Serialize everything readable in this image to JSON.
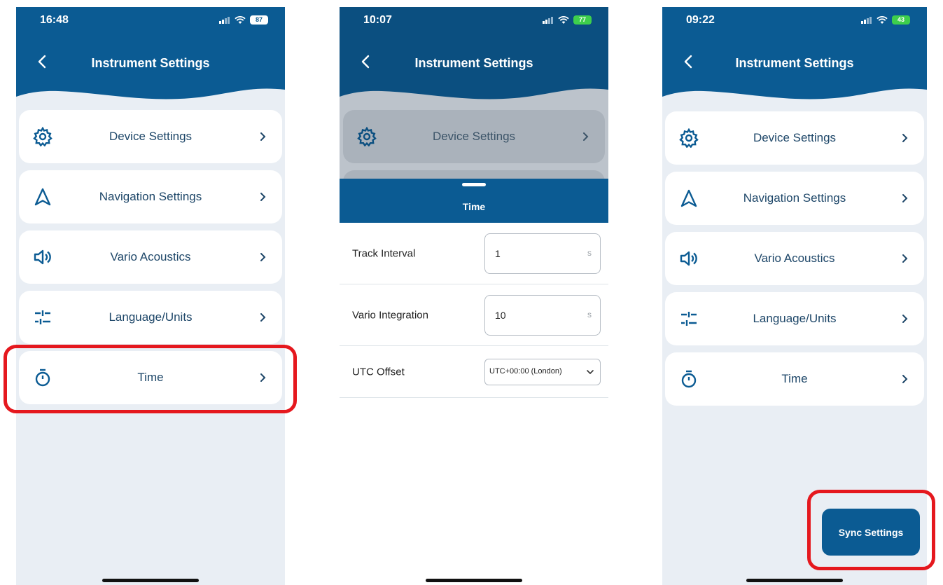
{
  "colors": {
    "header_blue": "#0b5b93",
    "background": "#e9eef4",
    "highlight": "#e5181e",
    "label_text": "#1d4668"
  },
  "phone1": {
    "status_time": "16:48",
    "battery": "87",
    "title": "Instrument Settings",
    "menu": [
      {
        "label": "Device Settings",
        "icon": "gear-icon"
      },
      {
        "label": "Navigation Settings",
        "icon": "navigation-arrow-icon"
      },
      {
        "label": "Vario Acoustics",
        "icon": "speaker-icon"
      },
      {
        "label": "Language/Units",
        "icon": "sliders-icon"
      },
      {
        "label": "Time",
        "icon": "stopwatch-icon"
      }
    ]
  },
  "phone2": {
    "status_time": "10:07",
    "battery": "77",
    "title": "Instrument Settings",
    "background_item": "Device Settings",
    "sheet_title": "Time",
    "fields": [
      {
        "label": "Track Interval",
        "value": "1",
        "unit": "s"
      },
      {
        "label": "Vario Integration",
        "value": "10",
        "unit": "s"
      }
    ],
    "utc": {
      "label": "UTC Offset",
      "value": "UTC+00:00 (London)"
    }
  },
  "phone3": {
    "status_time": "09:22",
    "battery": "43",
    "title": "Instrument Settings",
    "menu": [
      {
        "label": "Device Settings",
        "icon": "gear-icon"
      },
      {
        "label": "Navigation Settings",
        "icon": "navigation-arrow-icon"
      },
      {
        "label": "Vario Acoustics",
        "icon": "speaker-icon"
      },
      {
        "label": "Language/Units",
        "icon": "sliders-icon"
      },
      {
        "label": "Time",
        "icon": "stopwatch-icon"
      }
    ],
    "sync_button": "Sync Settings"
  }
}
